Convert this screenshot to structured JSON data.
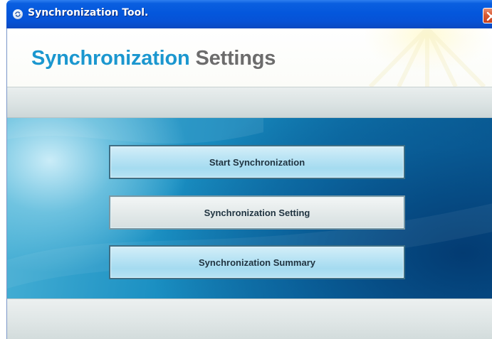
{
  "window": {
    "title": "Synchronization Tool."
  },
  "header": {
    "title_word1": "Synchronization",
    "title_word2": "Settings"
  },
  "menu": {
    "buttons": [
      {
        "label": "Start Synchronization"
      },
      {
        "label": "Synchronization Setting"
      },
      {
        "label": "Synchronization Summary"
      }
    ]
  },
  "icons": {
    "app": "sync-app-icon",
    "close": "close-icon"
  },
  "colors": {
    "title_bar": "#0457dc",
    "close_button": "#d95a33",
    "header_accent": "#1b97cf",
    "header_secondary": "#6c6c6c",
    "panel_background": "#0f73aa"
  }
}
